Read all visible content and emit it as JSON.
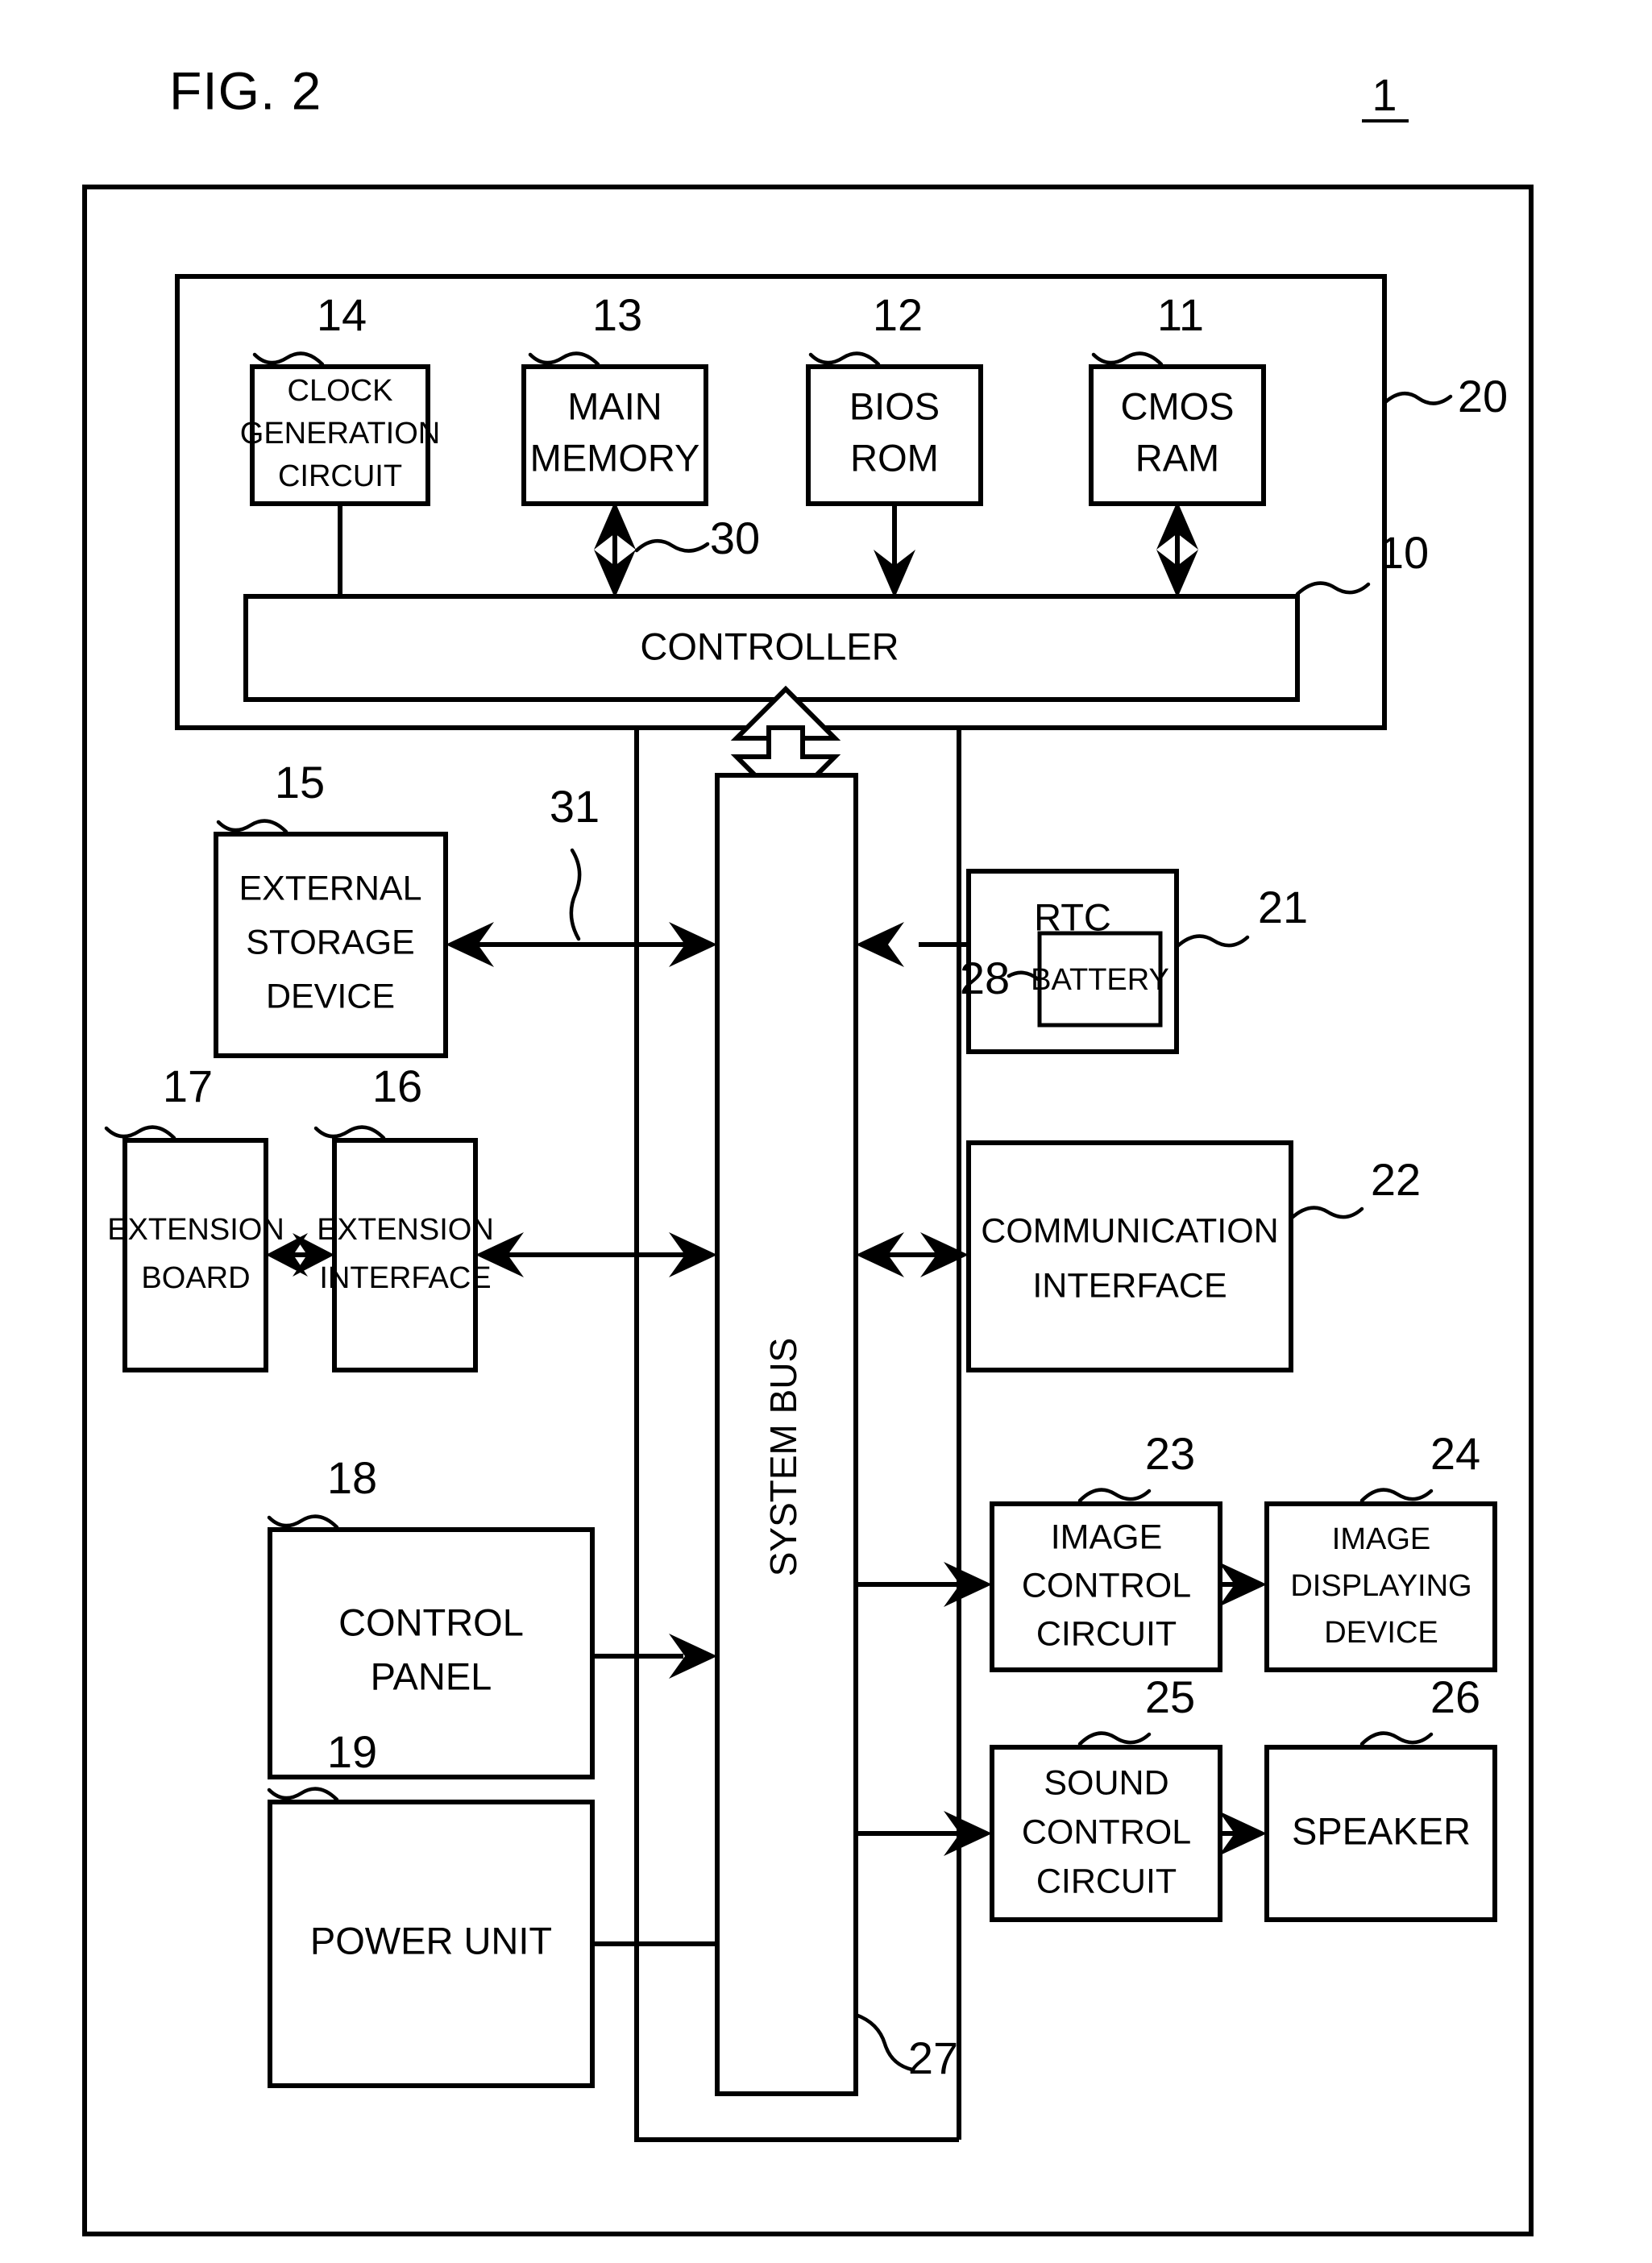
{
  "figure": {
    "title": "FIG. 2",
    "system_ref": "1"
  },
  "outer_frame": {
    "ref": null
  },
  "controller_group": {
    "ref": "20",
    "controller": {
      "label": "CONTROLLER",
      "ref": "10"
    },
    "bus_ref_controller_to_main_memory": "30",
    "blocks": [
      {
        "ref": "14",
        "lines": [
          "CLOCK",
          "GENERATION",
          "CIRCUIT"
        ]
      },
      {
        "ref": "13",
        "lines": [
          "MAIN",
          "MEMORY"
        ]
      },
      {
        "ref": "12",
        "lines": [
          "BIOS",
          "ROM"
        ]
      },
      {
        "ref": "11",
        "lines": [
          "CMOS",
          "RAM"
        ]
      }
    ]
  },
  "system_bus": {
    "label": "SYSTEM BUS",
    "ref": "27",
    "connection_ref": "31"
  },
  "peripherals": {
    "external_storage": {
      "ref": "15",
      "lines": [
        "EXTERNAL",
        "STORAGE",
        "DEVICE"
      ]
    },
    "rtc": {
      "ref": "21",
      "label": "RTC",
      "battery": {
        "ref": "28",
        "label": "BATTERY"
      }
    },
    "extension_board": {
      "ref": "17",
      "lines": [
        "EXTENSION",
        "BOARD"
      ]
    },
    "extension_interface": {
      "ref": "16",
      "lines": [
        "EXTENSION",
        "INTERFACE"
      ]
    },
    "communication_interface": {
      "ref": "22",
      "lines": [
        "COMMUNICATION",
        "INTERFACE"
      ]
    },
    "control_panel": {
      "ref": "18",
      "lines": [
        "CONTROL",
        "PANEL"
      ]
    },
    "image_control_circuit": {
      "ref": "23",
      "lines": [
        "IMAGE",
        "CONTROL",
        "CIRCUIT"
      ]
    },
    "image_displaying_device": {
      "ref": "24",
      "lines": [
        "IMAGE",
        "DISPLAYING",
        "DEVICE"
      ]
    },
    "power_unit": {
      "ref": "19",
      "lines": [
        "POWER UNIT"
      ]
    },
    "sound_control_circuit": {
      "ref": "25",
      "lines": [
        "SOUND",
        "CONTROL",
        "CIRCUIT"
      ]
    },
    "speaker": {
      "ref": "26",
      "lines": [
        "SPEAKER"
      ]
    }
  }
}
